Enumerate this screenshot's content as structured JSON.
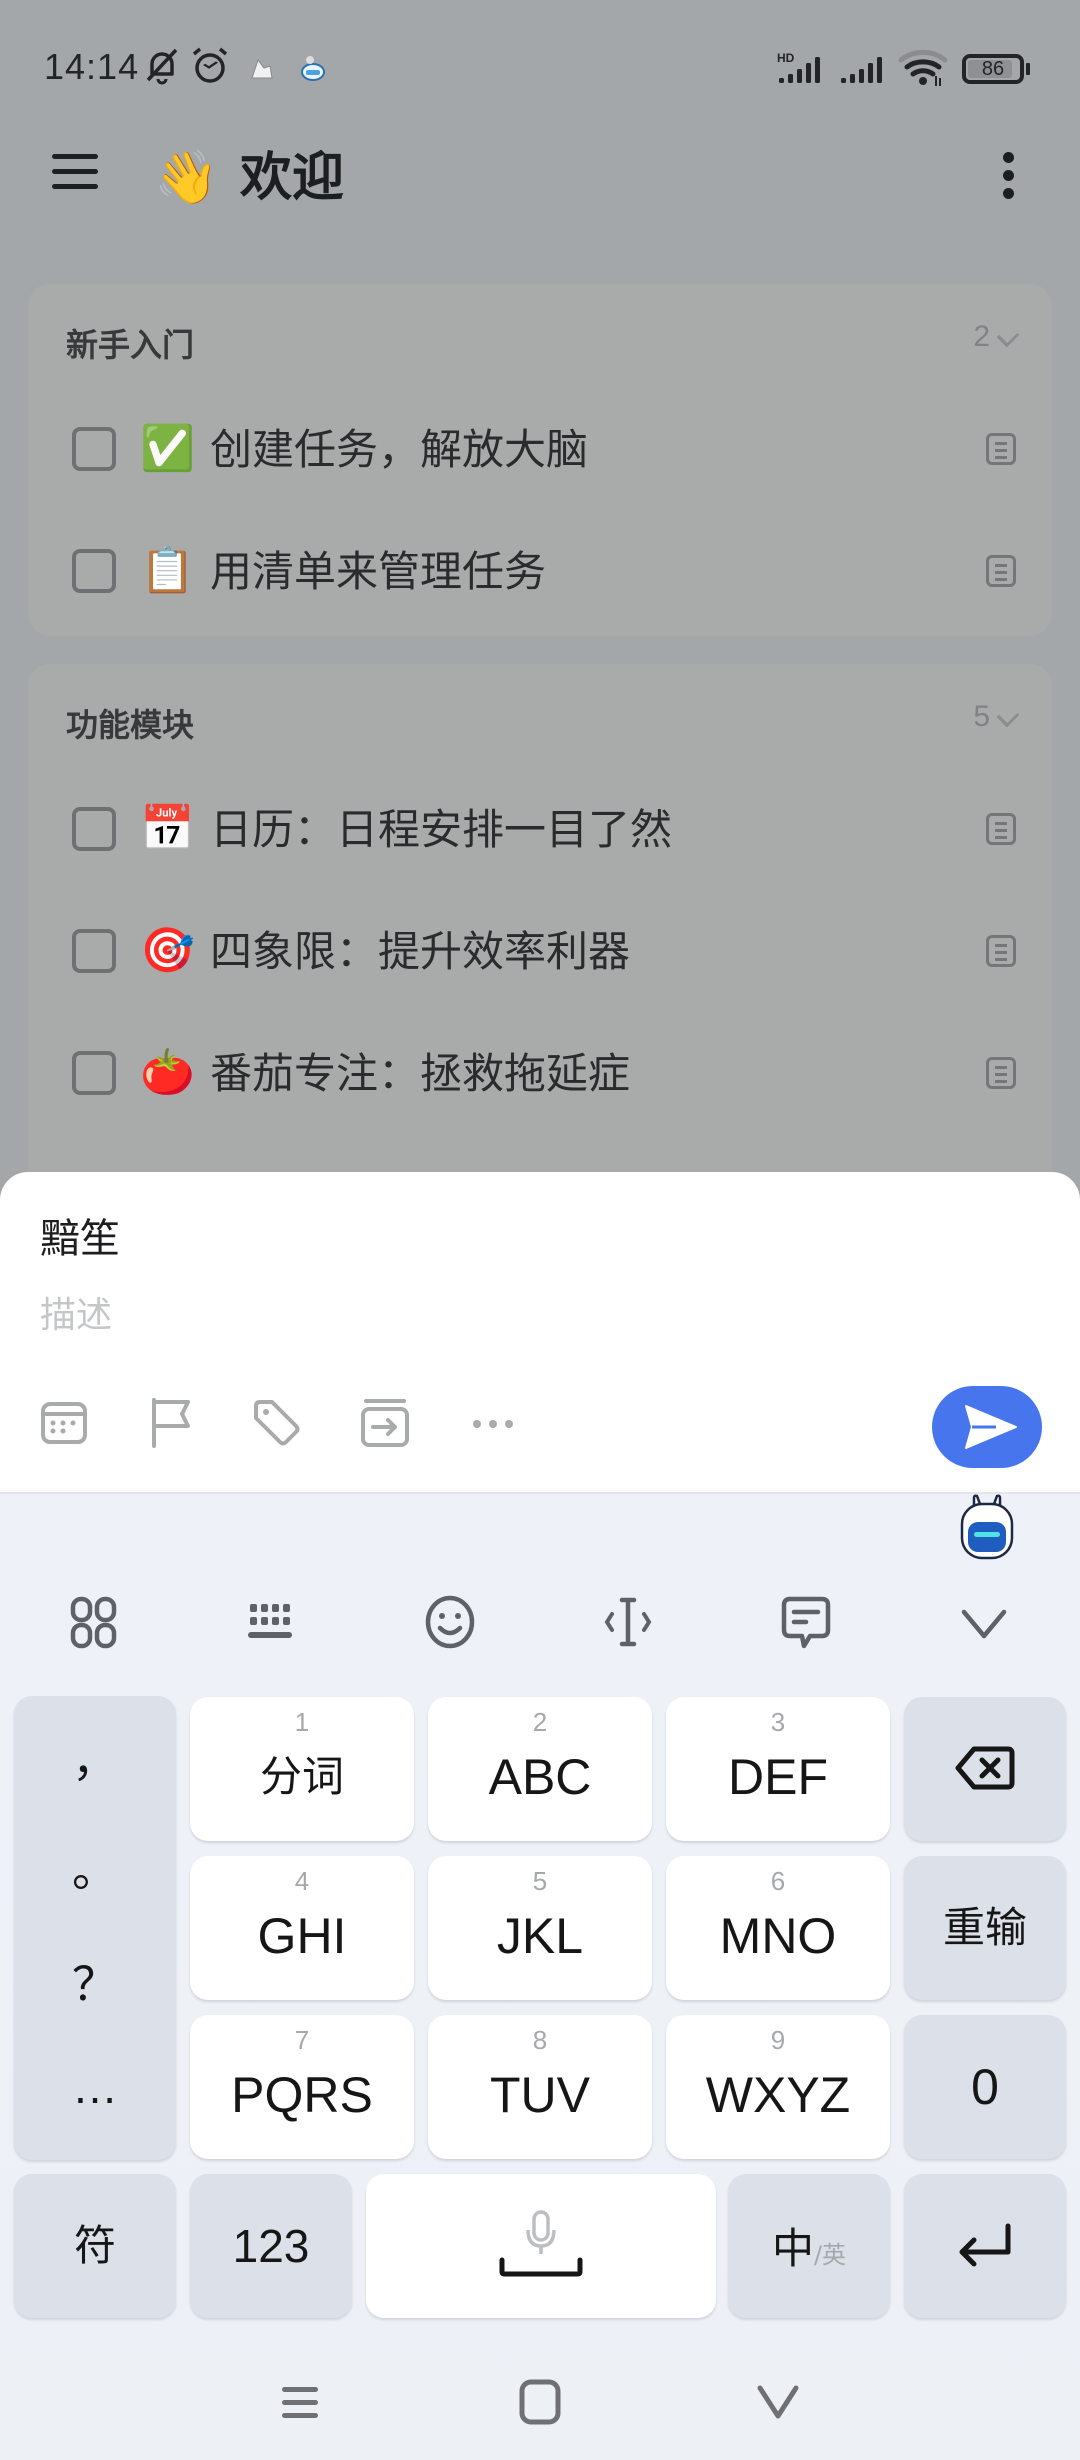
{
  "status_bar": {
    "time": "14:14",
    "icons": [
      "bell-off-icon",
      "alarm-icon",
      "notification-app-icon-1",
      "notification-app-icon-2"
    ],
    "right_icons": [
      "hd-signal-icon",
      "signal-icon",
      "wifi-icon"
    ],
    "battery": "86"
  },
  "header": {
    "emoji": "👋",
    "title": "欢迎"
  },
  "sections": [
    {
      "title": "新手入门",
      "count": "2",
      "tasks": [
        {
          "emoji": "✅",
          "text": "创建任务，解放大脑"
        },
        {
          "emoji": "📋",
          "text": "用清单来管理任务"
        }
      ]
    },
    {
      "title": "功能模块",
      "count": "5",
      "tasks": [
        {
          "emoji": "📅",
          "text": "日历：日程安排一目了然"
        },
        {
          "emoji": "🎯",
          "text": "四象限：提升效率利器"
        },
        {
          "emoji": "🍅",
          "text": "番茄专注：拯救拖延症"
        }
      ]
    }
  ],
  "quick_add": {
    "title_value": "黯笙",
    "description_placeholder": "描述",
    "tools": [
      "date-icon",
      "priority-flag-icon",
      "tag-icon",
      "move-to-list-icon",
      "more-icon"
    ],
    "accent": "#4775ed"
  },
  "keyboard": {
    "toolbar": [
      "apps-grid-icon",
      "keyboard-layout-icon",
      "emoji-icon",
      "cursor-icon",
      "clipboard-icon",
      "collapse-icon"
    ],
    "punctuation": [
      "，",
      "。",
      "？",
      "…"
    ],
    "keys": [
      {
        "num": "1",
        "label": "分词"
      },
      {
        "num": "2",
        "label": "ABC"
      },
      {
        "num": "3",
        "label": "DEF"
      },
      {
        "num": "4",
        "label": "GHI"
      },
      {
        "num": "5",
        "label": "JKL"
      },
      {
        "num": "6",
        "label": "MNO"
      },
      {
        "num": "7",
        "label": "PQRS"
      },
      {
        "num": "8",
        "label": "TUV"
      },
      {
        "num": "9",
        "label": "WXYZ"
      }
    ],
    "right_keys": {
      "reenter": "重输",
      "zero": "0"
    },
    "bottom": {
      "symbols": "符",
      "numbers": "123",
      "lang_main": "中",
      "lang_alt": "/英"
    }
  },
  "nav_bar": [
    "recents-icon",
    "home-icon",
    "back-icon"
  ]
}
